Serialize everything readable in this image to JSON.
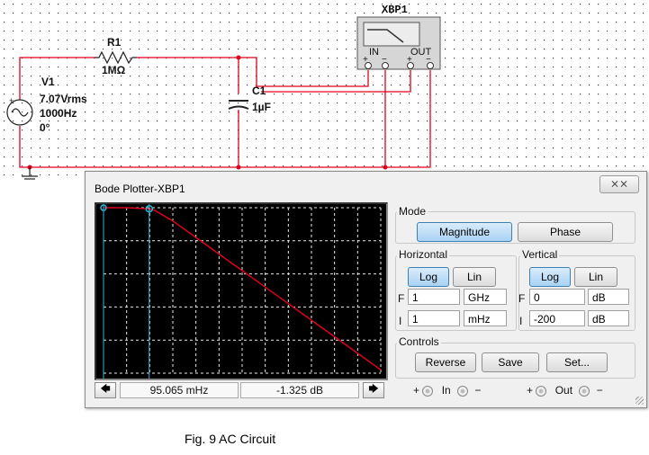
{
  "schematic": {
    "instrument_label": "XBP1",
    "instrument_in_label": "IN",
    "instrument_out_label": "OUT",
    "instrument_plus": "+",
    "instrument_minus": "−",
    "r1_name": "R1",
    "r1_value": "1MΩ",
    "c1_name": "C1",
    "c1_value": "1µF",
    "v1_name": "V1",
    "v1_amplitude": "7.07Vrms",
    "v1_frequency": "1000Hz",
    "v1_phase": "0°",
    "wire_color": "#e0001b"
  },
  "dialog": {
    "title": "Bode Plotter-XBP1",
    "close_glyph": "⨯⨯",
    "mode": {
      "title": "Mode",
      "magnitude_label": "Magnitude",
      "phase_label": "Phase",
      "selected": "Magnitude"
    },
    "horizontal": {
      "title": "Horizontal",
      "log_label": "Log",
      "lin_label": "Lin",
      "selected": "Log",
      "f_label": "F",
      "f_value": "1",
      "f_unit": "GHz",
      "i_label": "I",
      "i_value": "1",
      "i_unit": "mHz"
    },
    "vertical": {
      "title": "Vertical",
      "log_label": "Log",
      "lin_label": "Lin",
      "selected": "Log",
      "f_label": "F",
      "f_value": "0",
      "f_unit": "dB",
      "i_label": "I",
      "i_value": "-200",
      "i_unit": "dB"
    },
    "controls": {
      "title": "Controls",
      "reverse_label": "Reverse",
      "save_label": "Save",
      "set_label": "Set..."
    },
    "readout": {
      "left_arrow": "🡄",
      "right_arrow": "🡆",
      "frequency": "95.065 mHz",
      "magnitude": "-1.325 dB"
    },
    "terminals": {
      "in_plus": "+",
      "in_label": "In",
      "in_minus": "−",
      "out_plus": "+",
      "out_label": "Out",
      "out_minus": "−"
    },
    "plot_colors": {
      "background": "#000000",
      "grid": "#e8e8e8",
      "trace": "#e0001b",
      "cursor": "#29b6d8"
    }
  },
  "chart_data": {
    "type": "line",
    "x_scale": "log",
    "xlim_hz": [
      0.001,
      1000000000
    ],
    "ylim_db": [
      -200,
      0
    ],
    "cursor_frequency_hz": 0.095065,
    "series": [
      {
        "x": [
          0.001,
          0.01,
          0.095065,
          0.16,
          1,
          10,
          100,
          1000,
          10000,
          100000,
          1000000,
          10000000,
          100000000,
          1000000000
        ],
        "y": [
          0,
          0,
          -1.325,
          -3,
          -16,
          -36,
          -56,
          -76,
          -96,
          -116,
          -136,
          -156,
          -176,
          -196
        ]
      }
    ]
  },
  "caption": "Fig. 9 AC Circuit"
}
